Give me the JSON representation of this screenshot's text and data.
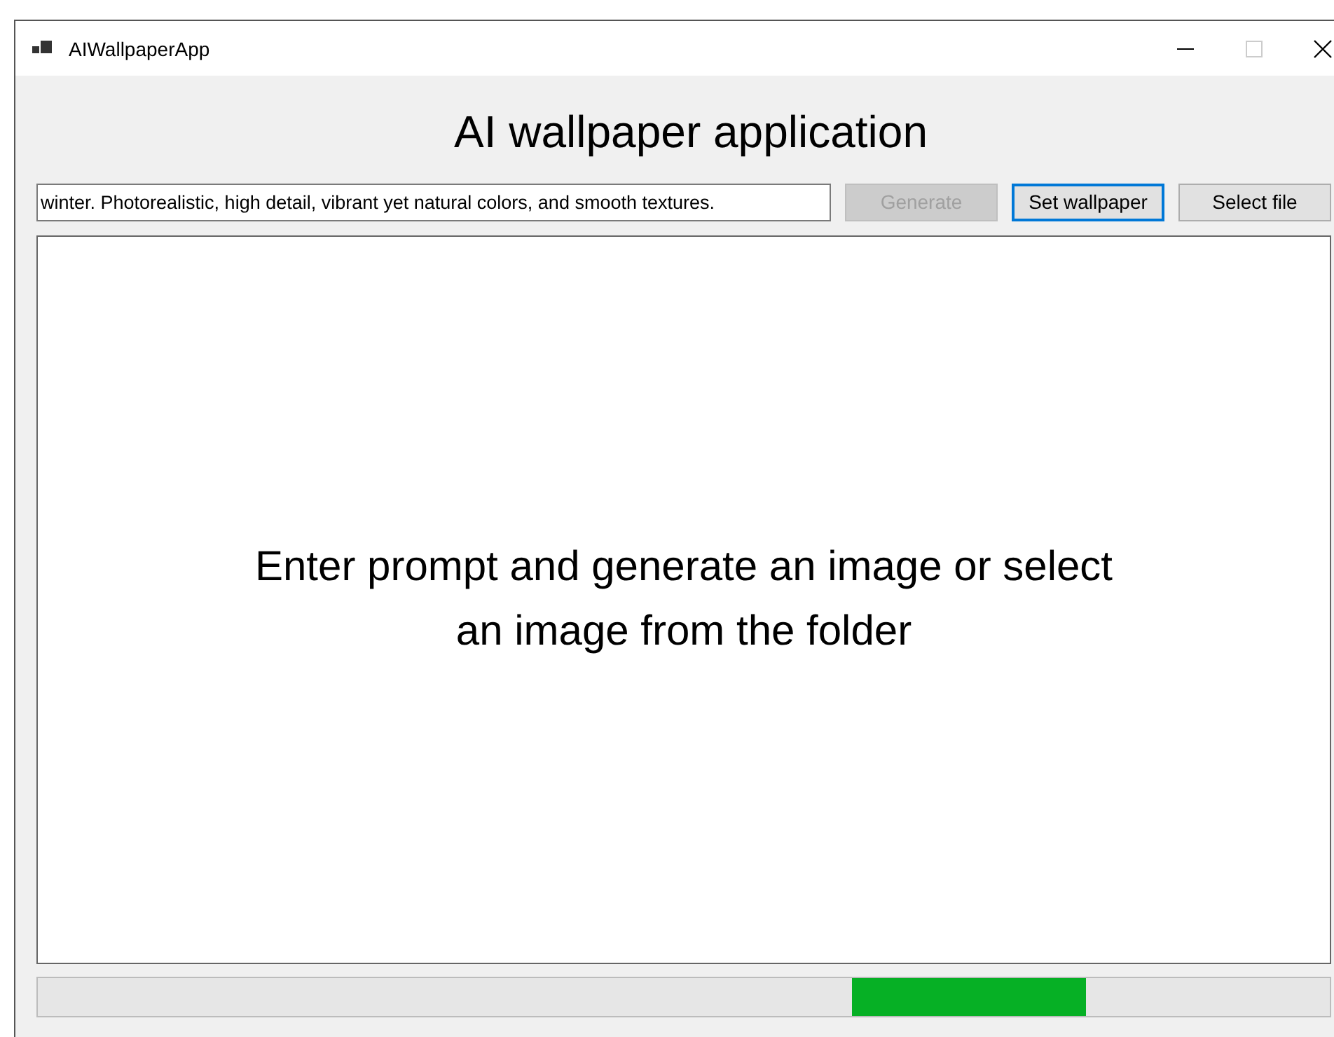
{
  "window": {
    "title": "AIWallpaperApp"
  },
  "heading": "AI wallpaper application",
  "prompt": {
    "value": "winter. Photorealistic, high detail, vibrant yet natural colors, and smooth textures."
  },
  "buttons": [
    {
      "label": "Generate",
      "disabled": true,
      "focused": false
    },
    {
      "label": "Set wallpaper",
      "disabled": false,
      "focused": true
    },
    {
      "label": "Select file",
      "disabled": false,
      "focused": false
    }
  ],
  "preview": {
    "message": "Enter prompt and generate an image or select an image from the folder"
  },
  "progress": {
    "kind": "marquee"
  }
}
